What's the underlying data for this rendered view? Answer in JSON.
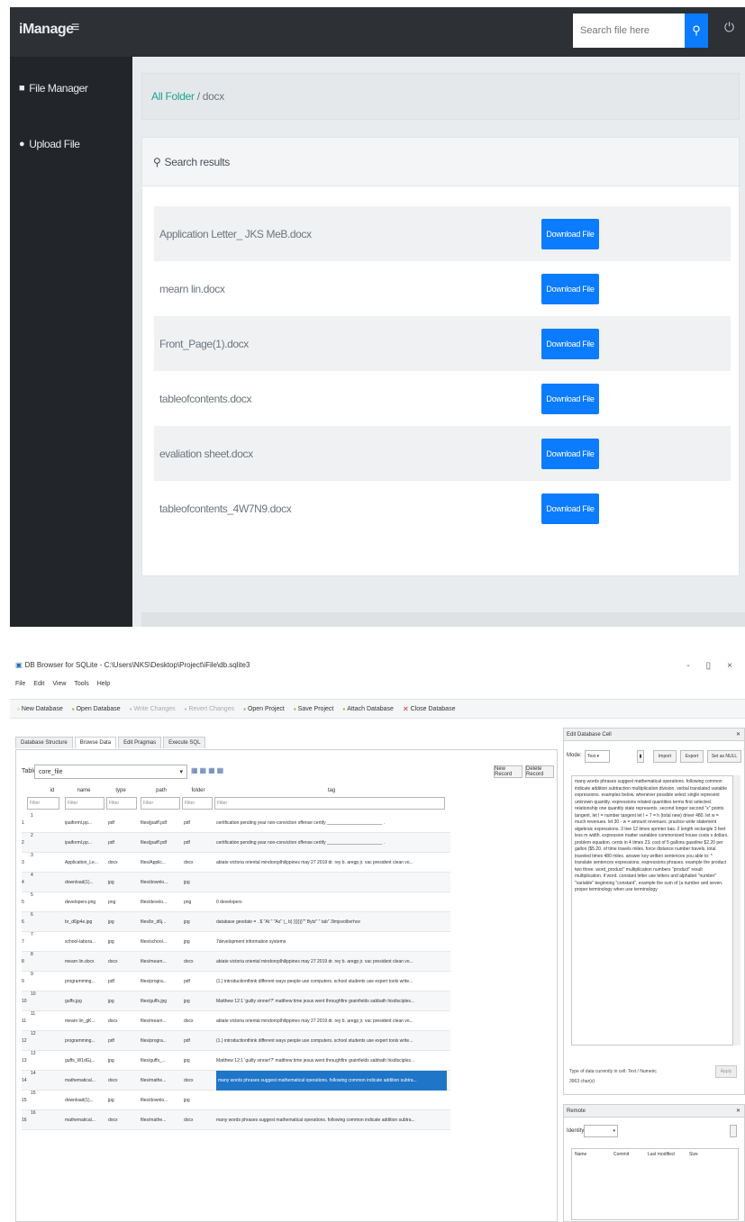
{
  "top": {
    "brand": "iManage",
    "menu_icon": "hamburger-icon",
    "search_placeholder": "Search file here",
    "search_btn_icon": "search-icon",
    "power_icon": "power-icon",
    "sidebar": [
      {
        "label": "File Manager",
        "icon": "file-icon"
      },
      {
        "label": "Upload File",
        "icon": "user-icon"
      }
    ],
    "breadcrumb": {
      "link": "All Folder",
      "sep": " / ",
      "current": "docx"
    },
    "card_header": "Search results",
    "download_label": "Download File",
    "files": [
      "Application Letter_ JKS MeB.docx",
      "mearn lin.docx",
      "Front_Page(1).docx",
      "tableofcontents.docx",
      "evaliation sheet.docx",
      "tableofcontents_4W7N9.docx"
    ]
  },
  "bottom": {
    "window_title": "DB Browser for SQLite - C:\\Users\\NKS\\Desktop\\Project\\iFile\\db.sqlite3",
    "window_controls": [
      "-",
      "▯",
      "×"
    ],
    "menu": [
      "File",
      "Edit",
      "View",
      "Tools",
      "Help"
    ],
    "toolbar": [
      {
        "label": "New Database",
        "dim": false
      },
      {
        "label": "Open Database",
        "dim": false
      },
      {
        "label": "Write Changes",
        "dim": true
      },
      {
        "label": "Revert Changes",
        "dim": true
      },
      {
        "label": "Open Project",
        "dim": false
      },
      {
        "label": "Save Project",
        "dim": false
      },
      {
        "label": "Attach Database",
        "dim": false
      },
      {
        "label": "Close Database",
        "dim": false
      }
    ],
    "tabs": [
      "Database Structure",
      "Browse Data",
      "Edit Pragmas",
      "Execute SQL"
    ],
    "table_label": "Table:",
    "table_value": "core_file",
    "new_record": "New Record",
    "delete_record": "Delete Record",
    "columns": [
      "id",
      "name",
      "type",
      "path",
      "folder",
      "tag"
    ],
    "filter_placeholder": "Filter",
    "rows": [
      {
        "n": "1",
        "id": "1",
        "name": "ipaiforml.pp...",
        "type": "pdf",
        "path": "files/jpaiff.pdf",
        "folder": "pdf",
        "tag": "certification pending year non-conviction offense certify ______________________ .",
        "sel": false
      },
      {
        "n": "2",
        "id": "2",
        "name": "ipaiforml.pp...",
        "type": "pdf",
        "path": "files/jpaiff.pdf",
        "folder": "pdf",
        "tag": "certification pending year non-conviction offense certify ______________________ .",
        "sel": false
      },
      {
        "n": "3",
        "id": "3",
        "name": "Application_Le...",
        "type": "docx",
        "path": "files/Applic...",
        "folder": "docx",
        "tag": "abiate victoria oriental mindoroplhilippines may 27 2019 dr. rey b. aregp jr. vac president clean vo...",
        "sel": false
      },
      {
        "n": "4",
        "id": "4",
        "name": "download(1)...",
        "type": "jpg",
        "path": "files/downlo...",
        "folder": "jpg",
        "tag": "",
        "sel": false
      },
      {
        "n": "5",
        "id": "5",
        "name": "developers.png",
        "type": "png",
        "path": "files/develo...",
        "folder": "png",
        "tag": "0 developers",
        "sel": false
      },
      {
        "n": "6",
        "id": "6",
        "name": "br_d6jp4e.jpg",
        "type": "jpg",
        "path": "files/br_d6j...",
        "folder": "jpg",
        "tag": "database geodate = . $ \"At \" \"As\" |_ b} }}}}}}\"\" Bytz\" \" tab\" 3lmjsvolbvrhce",
        "sel": false
      },
      {
        "n": "7",
        "id": "7",
        "name": "school-labora...",
        "type": "jpg",
        "path": "files/school...",
        "folder": "jpg",
        "tag": "7development information systems",
        "sel": false
      },
      {
        "n": "8",
        "id": "8",
        "name": "mearn lin.docx",
        "type": "docx",
        "path": "files/mearn...",
        "folder": "docx",
        "tag": "abiate victoria oriental mindoroplhilippines may 27 2019 dr. rey b. aregp jr. vac president clean vo...",
        "sel": false
      },
      {
        "n": "9",
        "id": "9",
        "name": "programming...",
        "type": "pdf",
        "path": "files/progra...",
        "folder": "pdf",
        "tag": "(1.) introductionthink different ways people use computers. school students use expert tools write...",
        "sel": false
      },
      {
        "n": "10",
        "id": "10",
        "name": "guffs.jpg",
        "type": "jpg",
        "path": "files/guffs.jpg",
        "folder": "jpg",
        "tag": "Matthew 12:1 'guilty sinner!?' matthew time jesus went throughfire grainfields sabbath hisdisciples...",
        "sel": false
      },
      {
        "n": "11",
        "id": "11",
        "name": "mearn lin_gK...",
        "type": "docx",
        "path": "files/mearn...",
        "folder": "docx",
        "tag": "abiate victoria oriental mindoroplhilippines may 27 2019 dr. rey b. aregp jr. vac president clean vo...",
        "sel": false
      },
      {
        "n": "12",
        "id": "12",
        "name": "programming...",
        "type": "pdf",
        "path": "files/progra...",
        "folder": "pdf",
        "tag": "(1.) introductionthink different ways people use computers. school students use expert tools write...",
        "sel": false
      },
      {
        "n": "13",
        "id": "13",
        "name": "guffs_W1dGj...",
        "type": "jpg",
        "path": "files/guffs_...",
        "folder": "jpg",
        "tag": "Matthew 12:1 'guilty sinner!?' matthew time jesus went throughfire grainfields sabbath hisdisciples...",
        "sel": false
      },
      {
        "n": "14",
        "id": "14",
        "name": "mathematical...",
        "type": "docx",
        "path": "files/mathe...",
        "folder": "docx",
        "tag": "many words phrases suggest mathematical operations. following common indicate addition subtra...",
        "sel": true
      },
      {
        "n": "15",
        "id": "15",
        "name": "download(1)...",
        "type": "jpg",
        "path": "files/downlo...",
        "folder": "jpg",
        "tag": "",
        "sel": false
      },
      {
        "n": "16",
        "id": "16",
        "name": "mathematical...",
        "type": "docx",
        "path": "files/mathe...",
        "folder": "docx",
        "tag": "many words phrases suggest mathematical operations. following common indicate addition subtra...",
        "sel": false
      }
    ],
    "edit_pane": {
      "title": "Edit Database Cell",
      "mode_label": "Mode:",
      "mode_value": "Text",
      "buttons": [
        "Import",
        "Export",
        "Set as NULL"
      ],
      "text": "many words phrases suggest mathematical operations. following common indicate addition subtraction multiplication division. verbal translated variable expressions. examples below. whenever possible select single represent unknown quantity. expressions related quantities terms first selected. relationship one quantity state represents. second longer second \"x\" points tangent. let l = number tangent let l + 7 = h (total new) driver 480. let w = much revenues. let 30 - w = amount revenues. practice write statement algebraic expressions. 3 tive 12 times sprinter bas. 2 length rectangle 3 feet less m width. expression matter variables commonized house costs s dollars. problem equation. cents in 4 times 23. cost of 5 gallons gasoline $2.20 per gallon ($5.20. of time travels miles. force distance number travels. total traveled times 480 miles. answer key written sentences you able to: * translate sentences expressions. expressions phrases. example the product two three. word_product\" multiplication numbers \"product\" result multiplication. if word. constant letter use letters and alphabet \"number\" \"variable\" beginning \"constant\", example the sum of (a number and seven. proper terminology when use terminology",
      "type_text": "Type of data currently in cell: Text / Numeric",
      "size_text": "3963 char(s)",
      "apply": "Apply"
    },
    "remote_pane": {
      "title": "Remote",
      "identity_label": "Identity",
      "columns": [
        "Name",
        "Commit",
        "Last modified",
        "Size"
      ]
    }
  }
}
